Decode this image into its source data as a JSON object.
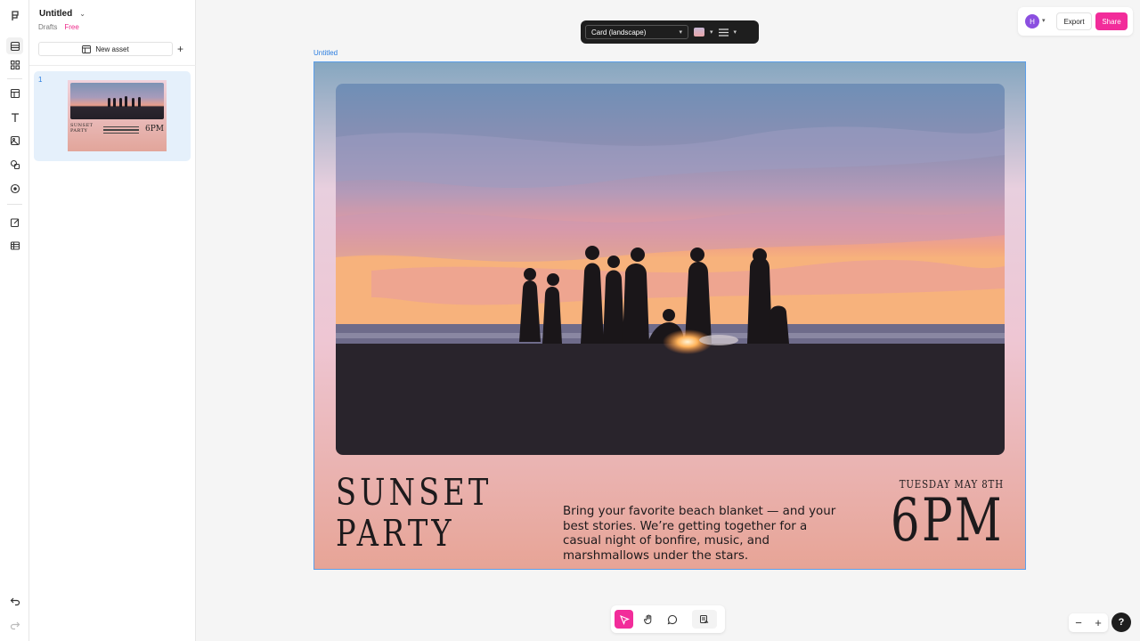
{
  "document": {
    "title": "Untitled",
    "location": "Drafts",
    "plan": "Free"
  },
  "panel": {
    "new_asset_label": "New asset",
    "add_icon": "+",
    "pages": [
      {
        "number": "1",
        "thumb_title": "SUNSET PARTY",
        "thumb_time": "6PM"
      }
    ]
  },
  "rail": {
    "icons": [
      "logo-icon",
      "layers-icon",
      "grid-icon",
      "layout-icon",
      "text-icon",
      "image-icon",
      "shapes-icon",
      "plus-circle-icon",
      "edit-icon",
      "table-icon",
      "undo-icon",
      "redo-icon"
    ]
  },
  "toolbar": {
    "format_value": "Card (landscape)"
  },
  "header": {
    "avatar_initial": "H",
    "export_label": "Export",
    "share_label": "Share"
  },
  "canvas": {
    "frame_label": "Untitled",
    "card": {
      "title_line1": "SUNSET",
      "title_line2": "PARTY",
      "body": "Bring your favorite beach blanket — and your best stories. We’re getting together for a casual night of bonfire, music, and marshmallows under the stars.",
      "date": "TUESDAY MAY 8TH",
      "time": "6PM"
    }
  },
  "bottom_tools": [
    "select-tool-icon",
    "hand-tool-icon",
    "comment-tool-icon",
    "assets-tool-icon"
  ],
  "zoom": {
    "minus": "−",
    "plus": "+"
  },
  "help_label": "?",
  "colors": {
    "accent": "#f22c9a",
    "selection": "#5b9ee9",
    "avatar": "#8b4fe0"
  }
}
